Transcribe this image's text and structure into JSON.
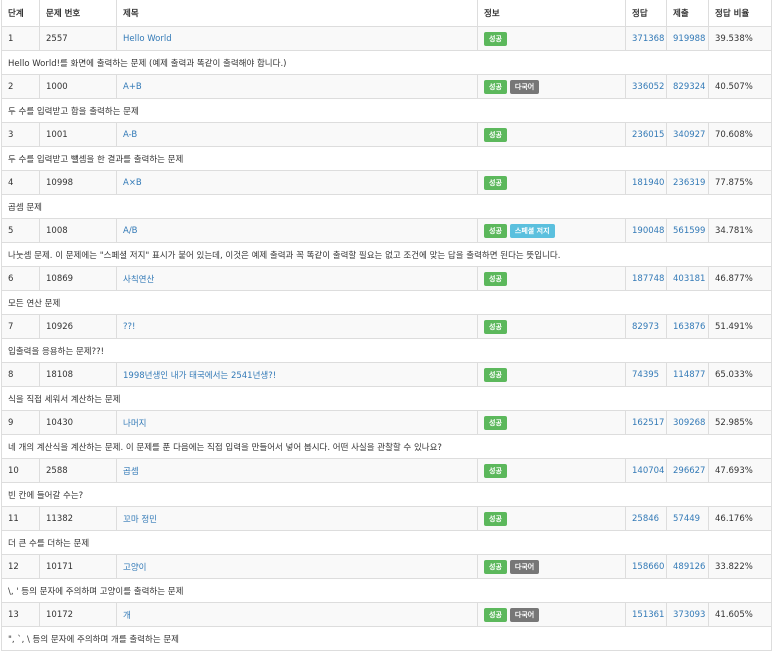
{
  "headers": {
    "step": "단계",
    "problem_id": "문제 번호",
    "title": "제목",
    "info": "정보",
    "accepted": "정답",
    "submissions": "제출",
    "ratio": "정답 비율"
  },
  "badges": {
    "success": "성공",
    "multilang": "다국어",
    "special": "스페셜 저지"
  },
  "colors": {
    "link": "#337ab7",
    "success": "#5cb85c",
    "multilang": "#777777",
    "special": "#5bc0de"
  },
  "problems": [
    {
      "step": "1",
      "id": "2557",
      "title": "Hello World",
      "accepted": "371368",
      "submissions": "919988",
      "ratio": "39.538%",
      "desc": "Hello World!를 화면에 출력하는 문제 (예제 출력과 똑같이 출력해야 합니다.)"
    },
    {
      "step": "2",
      "id": "1000",
      "title": "A+B",
      "accepted": "336052",
      "submissions": "829324",
      "ratio": "40.507%",
      "desc": "두 수를 입력받고 합을 출력하는 문제"
    },
    {
      "step": "3",
      "id": "1001",
      "title": "A-B",
      "accepted": "236015",
      "submissions": "340927",
      "ratio": "70.608%",
      "desc": "두 수를 입력받고 뺄셈을 한 결과를 출력하는 문제"
    },
    {
      "step": "4",
      "id": "10998",
      "title": "A×B",
      "accepted": "181940",
      "submissions": "236319",
      "ratio": "77.875%",
      "desc": "곱셈 문제"
    },
    {
      "step": "5",
      "id": "1008",
      "title": "A/B",
      "accepted": "190048",
      "submissions": "561599",
      "ratio": "34.781%",
      "desc": "나눗셈 문제. 이 문제에는 \"스페셜 저지\" 표시가 붙어 있는데, 이것은 예제 출력과 꼭 똑같이 출력할 필요는 없고 조건에 맞는 답을 출력하면 된다는 뜻입니다."
    },
    {
      "step": "6",
      "id": "10869",
      "title": "사칙연산",
      "accepted": "187748",
      "submissions": "403181",
      "ratio": "46.877%",
      "desc": "모든 연산 문제"
    },
    {
      "step": "7",
      "id": "10926",
      "title": "??!",
      "accepted": "82973",
      "submissions": "163876",
      "ratio": "51.491%",
      "desc": "입출력을 응용하는 문제??!"
    },
    {
      "step": "8",
      "id": "18108",
      "title": "1998년생인 내가 태국에서는 2541년생?!",
      "accepted": "74395",
      "submissions": "114877",
      "ratio": "65.033%",
      "desc": "식을 직접 세워서 계산하는 문제"
    },
    {
      "step": "9",
      "id": "10430",
      "title": "나머지",
      "accepted": "162517",
      "submissions": "309268",
      "ratio": "52.985%",
      "desc": "네 개의 계산식을 계산하는 문제. 이 문제를 푼 다음에는 직접 입력을 만들어서 넣어 봅시다. 어떤 사실을 관찰할 수 있나요?"
    },
    {
      "step": "10",
      "id": "2588",
      "title": "곱셈",
      "accepted": "140704",
      "submissions": "296627",
      "ratio": "47.693%",
      "desc": "빈 칸에 들어갈 수는?"
    },
    {
      "step": "11",
      "id": "11382",
      "title": "꼬마 정민",
      "accepted": "25846",
      "submissions": "57449",
      "ratio": "46.176%",
      "desc": "더 큰 수를 더하는 문제"
    },
    {
      "step": "12",
      "id": "10171",
      "title": "고양이",
      "accepted": "158660",
      "submissions": "489126",
      "ratio": "33.822%",
      "desc": "\\, ' 등의 문자에 주의하며 고양이를 출력하는 문제"
    },
    {
      "step": "13",
      "id": "10172",
      "title": "개",
      "accepted": "151361",
      "submissions": "373093",
      "ratio": "41.605%",
      "desc": "\", `, \\ 등의 문자에 주의하며 개를 출력하는 문제"
    }
  ]
}
